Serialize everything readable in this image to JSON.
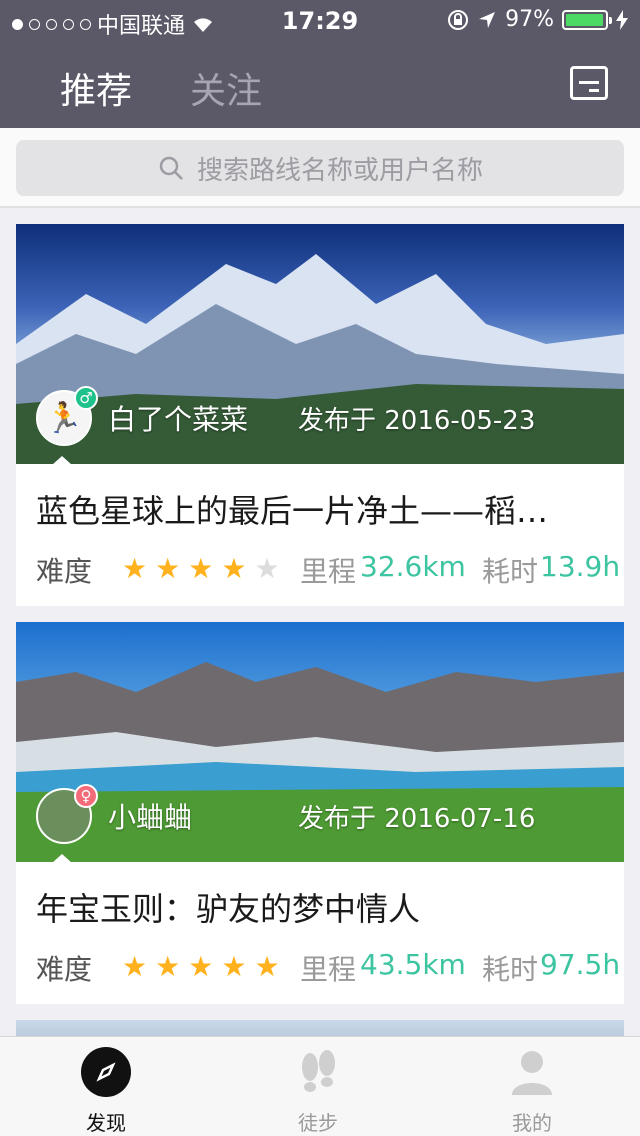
{
  "status": {
    "carrier": "中国联通",
    "time": "17:29",
    "battery": "97%",
    "battery_level": 0.97
  },
  "nav": {
    "tab_recommend": "推荐",
    "tab_follow": "关注",
    "map_icon": "map-icon"
  },
  "search": {
    "placeholder": "搜索路线名称或用户名称",
    "icon": "search-icon"
  },
  "routes": [
    {
      "author": "白了个菜菜",
      "gender_symbol": "♂",
      "published": "发布于 2016-05-23",
      "title": "蓝色星球上的最后一片净土——稻…",
      "difficulty_label": "难度",
      "difficulty_stars": 4,
      "distance_label": "里程",
      "distance": "32.6km",
      "duration_label": "耗时",
      "duration": "13.9h"
    },
    {
      "author": "小蛐蛐",
      "gender_symbol": "♀",
      "published": "发布于 2016-07-16",
      "title": "年宝玉则：驴友的梦中情人",
      "difficulty_label": "难度",
      "difficulty_stars": 5,
      "distance_label": "里程",
      "distance": "43.5km",
      "duration_label": "耗时",
      "duration": "97.5h"
    }
  ],
  "tabbar": {
    "items": [
      {
        "label": "发现",
        "icon": "compass-icon",
        "active": true
      },
      {
        "label": "徒步",
        "icon": "footprints-icon",
        "active": false
      },
      {
        "label": "我的",
        "icon": "person-icon",
        "active": false
      }
    ]
  },
  "colors": {
    "header_bg": "#5b5868",
    "accent_green": "#3dc4a0",
    "star": "#ffb21d"
  }
}
